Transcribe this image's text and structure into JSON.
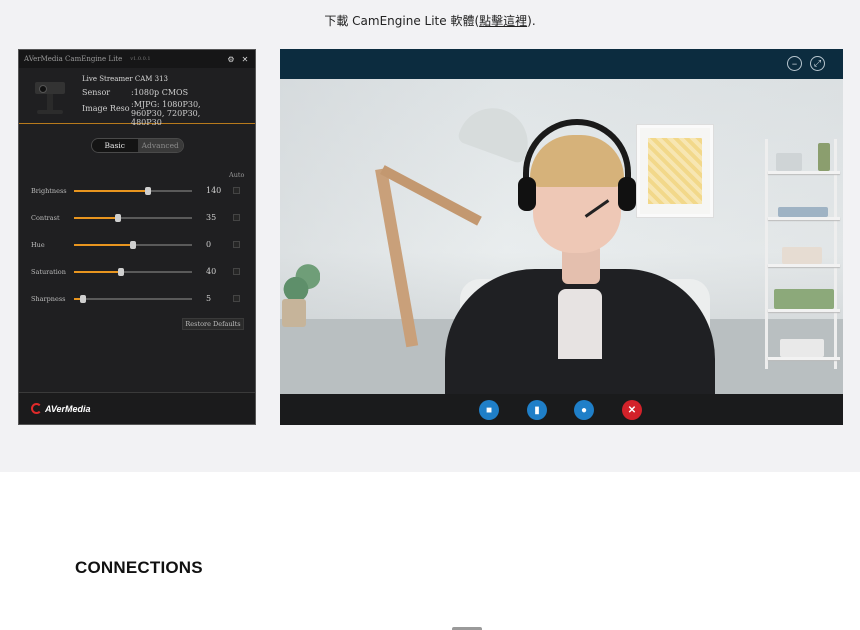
{
  "download": {
    "prefix": "下載 CamEngine Lite 軟體(",
    "link": "點擊這裡",
    "suffix": ")."
  },
  "camengine": {
    "title": "AVerMedia CamEngine Lite",
    "version": "v1.0.0.1",
    "model": "Live Streamer CAM 313",
    "sensor_label": "Sensor",
    "sensor_value": ":1080p CMOS",
    "reso_label": "Image Reso",
    "reso_value": ":MJPG: 1080P30, 960P30, 720P30, 480P30",
    "tabs": [
      "Basic",
      "Advanced"
    ],
    "active_tab": "Basic",
    "auto_label": "Auto",
    "sliders": [
      {
        "label": "Brightness",
        "value": "140",
        "fraction": 0.63
      },
      {
        "label": "Contrast",
        "value": "35",
        "fraction": 0.37
      },
      {
        "label": "Hue",
        "value": "0",
        "fraction": 0.5
      },
      {
        "label": "Saturation",
        "value": "40",
        "fraction": 0.4
      },
      {
        "label": "Sharpness",
        "value": "5",
        "fraction": 0.08
      }
    ],
    "restore_label": "Restore Defaults",
    "brand": "AVerMedia",
    "accent_color": "#e8951f"
  },
  "video_call": {
    "window_buttons": [
      "minimize-icon",
      "fullscreen-icon"
    ],
    "call_buttons": [
      {
        "icon": "video-camera-icon",
        "color": "#1f7fc8"
      },
      {
        "icon": "signal-bars-icon",
        "color": "#1f7fc8"
      },
      {
        "icon": "chat-bubble-icon",
        "color": "#1f7fc8"
      },
      {
        "icon": "hang-up-icon",
        "color": "#d3222a"
      }
    ]
  },
  "section": {
    "heading": "CONNECTIONS"
  }
}
